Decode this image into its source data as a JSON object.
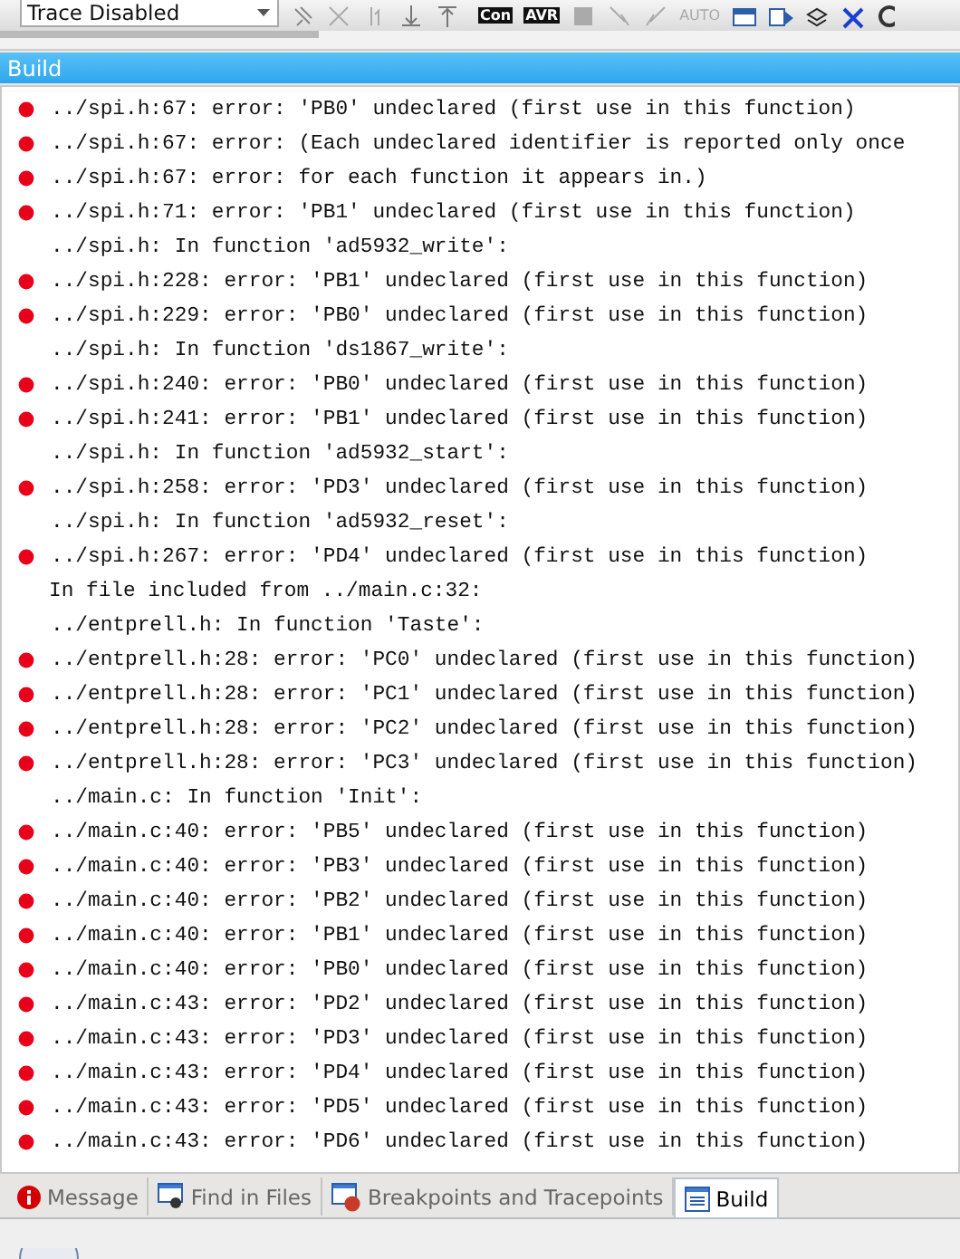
{
  "toolbar": {
    "trace_select": {
      "value": "Trace Disabled"
    },
    "chip_labels": [
      "Con",
      "AVR"
    ],
    "auto_label": "AUTO"
  },
  "panel": {
    "title": "Build"
  },
  "messages": [
    {
      "kind": "error",
      "text": "../spi.h:67: error: 'PB0' undeclared (first use in this function)"
    },
    {
      "kind": "error",
      "text": "../spi.h:67: error: (Each undeclared identifier is reported only once"
    },
    {
      "kind": "error",
      "text": "../spi.h:67: error: for each function it appears in.)"
    },
    {
      "kind": "error",
      "text": "../spi.h:71: error: 'PB1' undeclared (first use in this function)"
    },
    {
      "kind": "info",
      "text": "../spi.h: In function 'ad5932_write':"
    },
    {
      "kind": "error",
      "text": "../spi.h:228: error: 'PB1' undeclared (first use in this function)"
    },
    {
      "kind": "error",
      "text": "../spi.h:229: error: 'PB0' undeclared (first use in this function)"
    },
    {
      "kind": "info",
      "text": "../spi.h: In function 'ds1867_write':"
    },
    {
      "kind": "error",
      "text": "../spi.h:240: error: 'PB0' undeclared (first use in this function)"
    },
    {
      "kind": "error",
      "text": "../spi.h:241: error: 'PB1' undeclared (first use in this function)"
    },
    {
      "kind": "info",
      "text": "../spi.h: In function 'ad5932_start':"
    },
    {
      "kind": "error",
      "text": "../spi.h:258: error: 'PD3' undeclared (first use in this function)"
    },
    {
      "kind": "info",
      "text": "../spi.h: In function 'ad5932_reset':"
    },
    {
      "kind": "error",
      "text": "../spi.h:267: error: 'PD4' undeclared (first use in this function)"
    },
    {
      "kind": "plain",
      "text": "In file included from ../main.c:32:"
    },
    {
      "kind": "info",
      "text": "../entprell.h: In function 'Taste':"
    },
    {
      "kind": "error",
      "text": "../entprell.h:28: error: 'PC0' undeclared (first use in this function)"
    },
    {
      "kind": "error",
      "text": "../entprell.h:28: error: 'PC1' undeclared (first use in this function)"
    },
    {
      "kind": "error",
      "text": "../entprell.h:28: error: 'PC2' undeclared (first use in this function)"
    },
    {
      "kind": "error",
      "text": "../entprell.h:28: error: 'PC3' undeclared (first use in this function)"
    },
    {
      "kind": "info",
      "text": "../main.c: In function 'Init':"
    },
    {
      "kind": "error",
      "text": "../main.c:40: error: 'PB5' undeclared (first use in this function)"
    },
    {
      "kind": "error",
      "text": "../main.c:40: error: 'PB3' undeclared (first use in this function)"
    },
    {
      "kind": "error",
      "text": "../main.c:40: error: 'PB2' undeclared (first use in this function)"
    },
    {
      "kind": "error",
      "text": "../main.c:40: error: 'PB1' undeclared (first use in this function)"
    },
    {
      "kind": "error",
      "text": "../main.c:40: error: 'PB0' undeclared (first use in this function)"
    },
    {
      "kind": "error",
      "text": "../main.c:43: error: 'PD2' undeclared (first use in this function)"
    },
    {
      "kind": "error",
      "text": "../main.c:43: error: 'PD3' undeclared (first use in this function)"
    },
    {
      "kind": "error",
      "text": "../main.c:43: error: 'PD4' undeclared (first use in this function)"
    },
    {
      "kind": "error",
      "text": "../main.c:43: error: 'PD5' undeclared (first use in this function)"
    },
    {
      "kind": "error",
      "text": "../main.c:43: error: 'PD6' undeclared (first use in this function)"
    }
  ],
  "tabs": [
    {
      "label": "Message",
      "kind": "message",
      "selected": false
    },
    {
      "label": "Find in Files",
      "kind": "find",
      "selected": false
    },
    {
      "label": "Breakpoints and Tracepoints",
      "kind": "breakpoints",
      "selected": false
    },
    {
      "label": "Build",
      "kind": "build",
      "selected": true
    }
  ]
}
